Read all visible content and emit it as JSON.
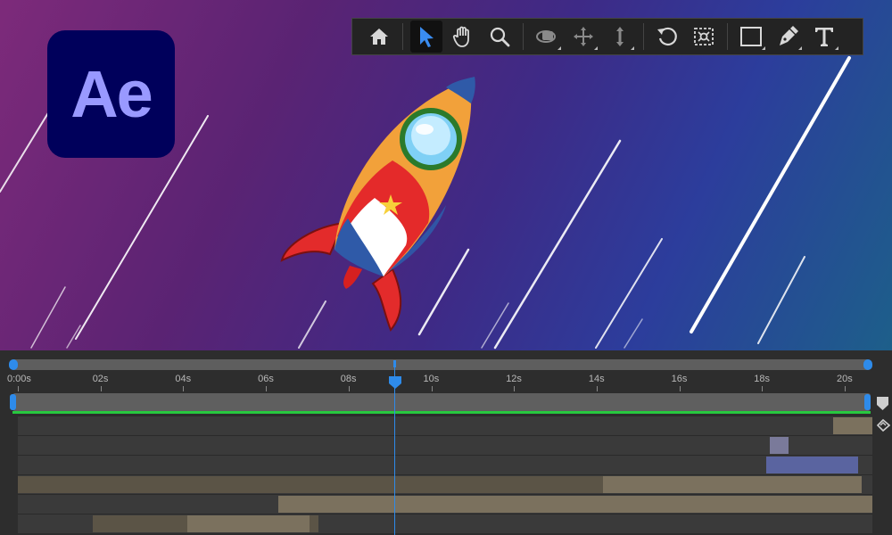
{
  "app": {
    "logo_text": "Ae"
  },
  "toolbar": {
    "tools": [
      {
        "name": "home-icon",
        "active": false
      },
      {
        "name": "selection-arrow-icon",
        "active": true
      },
      {
        "name": "hand-icon",
        "active": false
      },
      {
        "name": "zoom-icon",
        "active": false
      },
      {
        "name": "orbit-camera-icon",
        "active": false
      },
      {
        "name": "pan-camera-icon",
        "active": false
      },
      {
        "name": "dolly-camera-icon",
        "active": false
      },
      {
        "name": "rotate-icon",
        "active": false
      },
      {
        "name": "anchor-point-icon",
        "active": false
      },
      {
        "name": "rectangle-icon",
        "active": false
      },
      {
        "name": "pen-icon",
        "active": false
      },
      {
        "name": "type-icon",
        "active": false
      }
    ]
  },
  "timeline": {
    "ruler_labels": [
      "0:00s",
      "02s",
      "04s",
      "06s",
      "08s",
      "10s",
      "12s",
      "14s",
      "16s",
      "18s",
      "20s"
    ],
    "playhead_time_s": 9.2,
    "colors": {
      "accent": "#2e8bea",
      "work_area_active": "#27c93f",
      "clip_tan": "#7b715e",
      "clip_tan_dark": "#5b5446",
      "clip_lavender": "#7a7a9a",
      "clip_blue": "#5a64a0"
    }
  },
  "stage": {
    "background_colors": [
      "#7d2a7a",
      "#3e2a86",
      "#1d5f8a"
    ],
    "elements": [
      "rocket-illustration",
      "speed-streaks"
    ]
  }
}
